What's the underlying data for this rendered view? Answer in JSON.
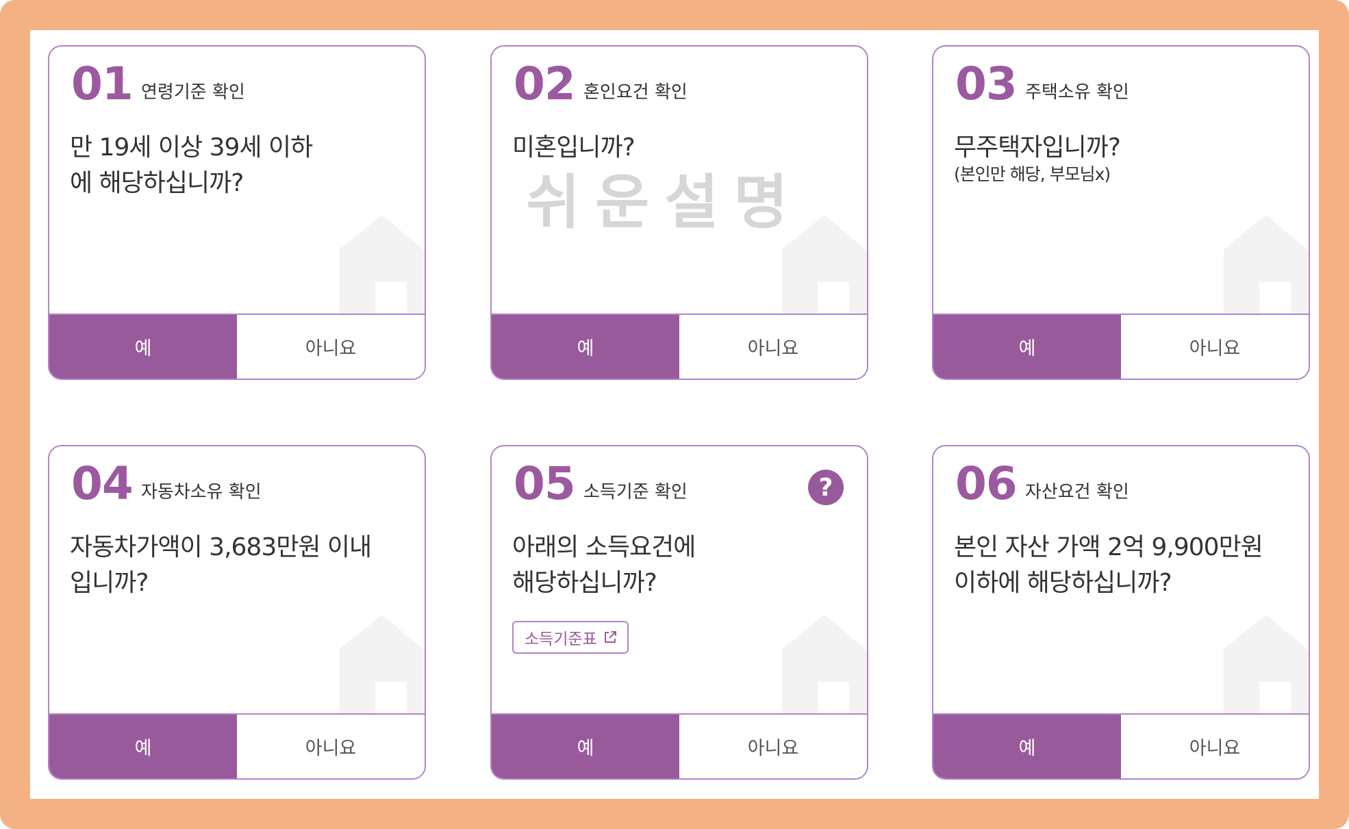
{
  "cards": [
    {
      "number": "01",
      "category": "연령기준 확인",
      "question": "만 19세 이상 39세 이하에 해당하십니까?",
      "yes": "예",
      "no": "아니요"
    },
    {
      "number": "02",
      "category": "혼인요건 확인",
      "question": "미혼입니까?",
      "watermark": "쉬운설명",
      "yes": "예",
      "no": "아니요"
    },
    {
      "number": "03",
      "category": "주택소유 확인",
      "question": "무주택자입니까?",
      "note": "(본인만 해당, 부모님x)",
      "yes": "예",
      "no": "아니요"
    },
    {
      "number": "04",
      "category": "자동차소유 확인",
      "question": "자동차가액이 3,683만원 이내 입니까?",
      "yes": "예",
      "no": "아니요"
    },
    {
      "number": "05",
      "category": "소득기준 확인",
      "question": "아래의 소득요건에 해당하십니까?",
      "help_icon": "?",
      "link_label": "소득기준표",
      "yes": "예",
      "no": "아니요"
    },
    {
      "number": "06",
      "category": "자산요건 확인",
      "question": "본인 자산 가액 2억 9,900만원 이하에 해당하십니까?",
      "yes": "예",
      "no": "아니요"
    }
  ],
  "colors": {
    "accent": "#995a9c",
    "number": "#9b5aa0",
    "border": "#b283c7",
    "frame": "#f4b183",
    "house": "#f3f3f3"
  },
  "icons": {
    "background": "house-icon",
    "help": "question-circle-icon",
    "link": "external-link-icon"
  }
}
